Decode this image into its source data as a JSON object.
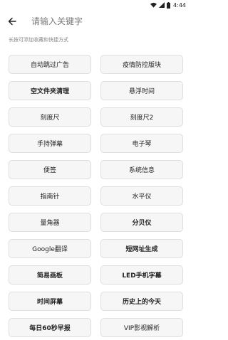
{
  "status": {
    "time": "4:44"
  },
  "search": {
    "placeholder": "请输入关键字"
  },
  "hint": "长按可添加收藏和快捷方式",
  "tools": [
    {
      "label": "自动跳过广告",
      "bold": false
    },
    {
      "label": "疫情防控版块",
      "bold": false
    },
    {
      "label": "空文件夹清理",
      "bold": true
    },
    {
      "label": "悬浮时间",
      "bold": false
    },
    {
      "label": "刻度尺",
      "bold": false
    },
    {
      "label": "刻度尺2",
      "bold": false
    },
    {
      "label": "手持弹幕",
      "bold": false
    },
    {
      "label": "电子琴",
      "bold": false
    },
    {
      "label": "便签",
      "bold": false
    },
    {
      "label": "系统信息",
      "bold": false
    },
    {
      "label": "指南针",
      "bold": false
    },
    {
      "label": "水平仪",
      "bold": false
    },
    {
      "label": "量角器",
      "bold": false
    },
    {
      "label": "分贝仪",
      "bold": true
    },
    {
      "label": "Google翻译",
      "bold": false
    },
    {
      "label": "短网址生成",
      "bold": true
    },
    {
      "label": "简易画板",
      "bold": true
    },
    {
      "label": "LED手机字幕",
      "bold": true
    },
    {
      "label": "时间屏幕",
      "bold": true
    },
    {
      "label": "历史上的今天",
      "bold": true
    },
    {
      "label": "每日60秒早报",
      "bold": true
    },
    {
      "label": "VIP影视解析",
      "bold": false
    }
  ]
}
